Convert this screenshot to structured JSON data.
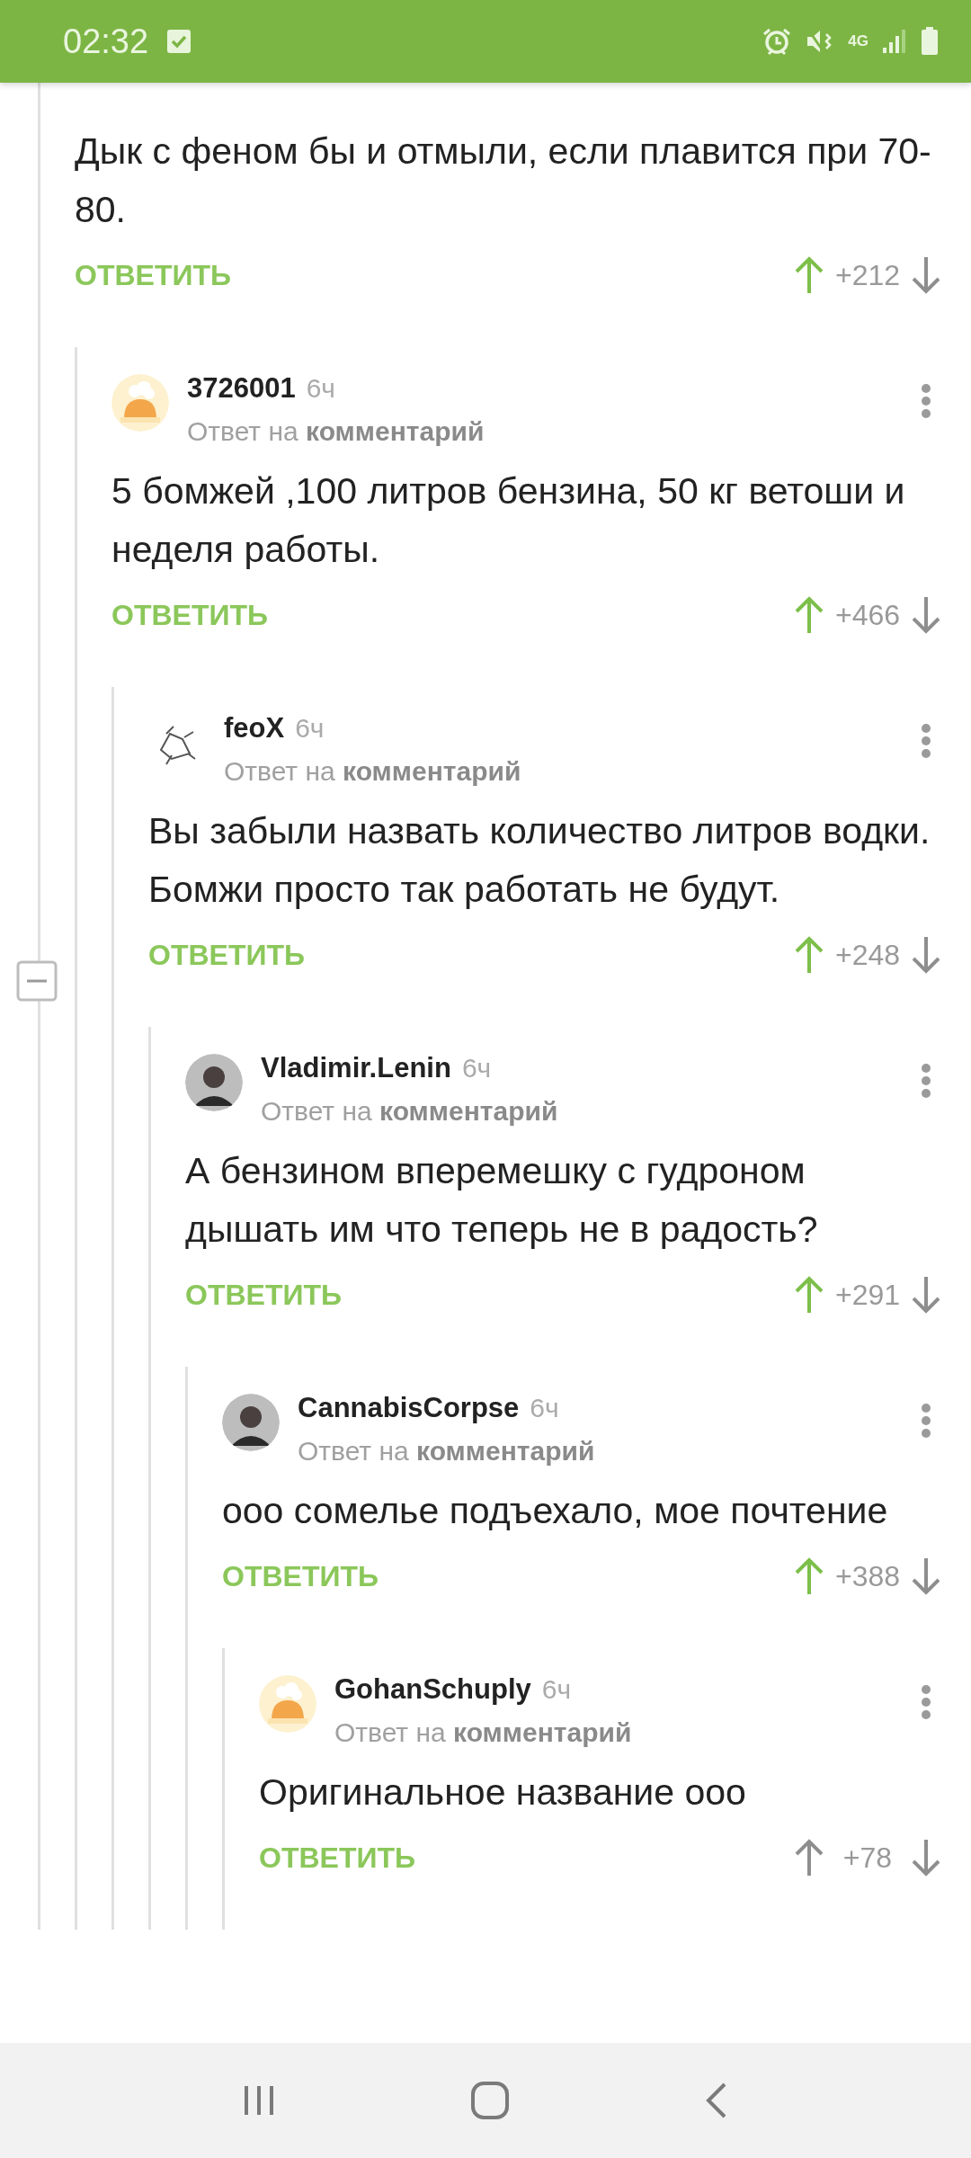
{
  "status_bar": {
    "time": "02:32",
    "network": "4G"
  },
  "comments": [
    {
      "body": "Дык с феном бы и отмыли, если плавится при 70-80.",
      "reply_label": "ОТВЕТИТЬ",
      "score": "+212",
      "voted_up": true,
      "collapsed": false,
      "children": [
        {
          "author": "3726001",
          "time": "6ч",
          "reply_to": "Ответ на **комментарий**",
          "avatar": {
            "kind": "chef"
          },
          "body": "5 бомжей ,100 литров бензина, 50 кг ветоши и неделя работы.",
          "reply_label": "ОТВЕТИТЬ",
          "score": "+466",
          "voted_up": true,
          "children": [
            {
              "author": "feoX",
              "time": "6ч",
              "reply_to": "Ответ на **комментарий**",
              "avatar": {
                "kind": "sketch"
              },
              "body": "Вы забыли назвать количество литров водки. Бомжи просто так работать не будут.",
              "reply_label": "ОТВЕТИТЬ",
              "score": "+248",
              "voted_up": true,
              "children": [
                {
                  "author": "Vladimir.Lenin",
                  "time": "6ч",
                  "reply_to": "Ответ на **комментарий**",
                  "avatar": {
                    "kind": "photo"
                  },
                  "body": "А бензином вперемешку с гудроном дышать им что теперь не в радость?",
                  "reply_label": "ОТВЕТИТЬ",
                  "score": "+291",
                  "voted_up": true,
                  "children": [
                    {
                      "author": "CannabisCorpse",
                      "time": "6ч",
                      "reply_to": "Ответ на **комментарий**",
                      "avatar": {
                        "kind": "photo"
                      },
                      "body": "ооо сомелье подъехало, мое почтение",
                      "reply_label": "ОТВЕТИТЬ",
                      "score": "+388",
                      "voted_up": true,
                      "children": [
                        {
                          "author": "GohanSchuply",
                          "time": "6ч",
                          "reply_to": "Ответ на **комментарий**",
                          "avatar": {
                            "kind": "chef"
                          },
                          "body": "Оригинальное название ооо",
                          "reply_label": "ОТВЕТИТЬ",
                          "score": "+78",
                          "voted_up": false
                        }
                      ]
                    }
                  ]
                }
              ]
            }
          ]
        }
      ]
    }
  ]
}
